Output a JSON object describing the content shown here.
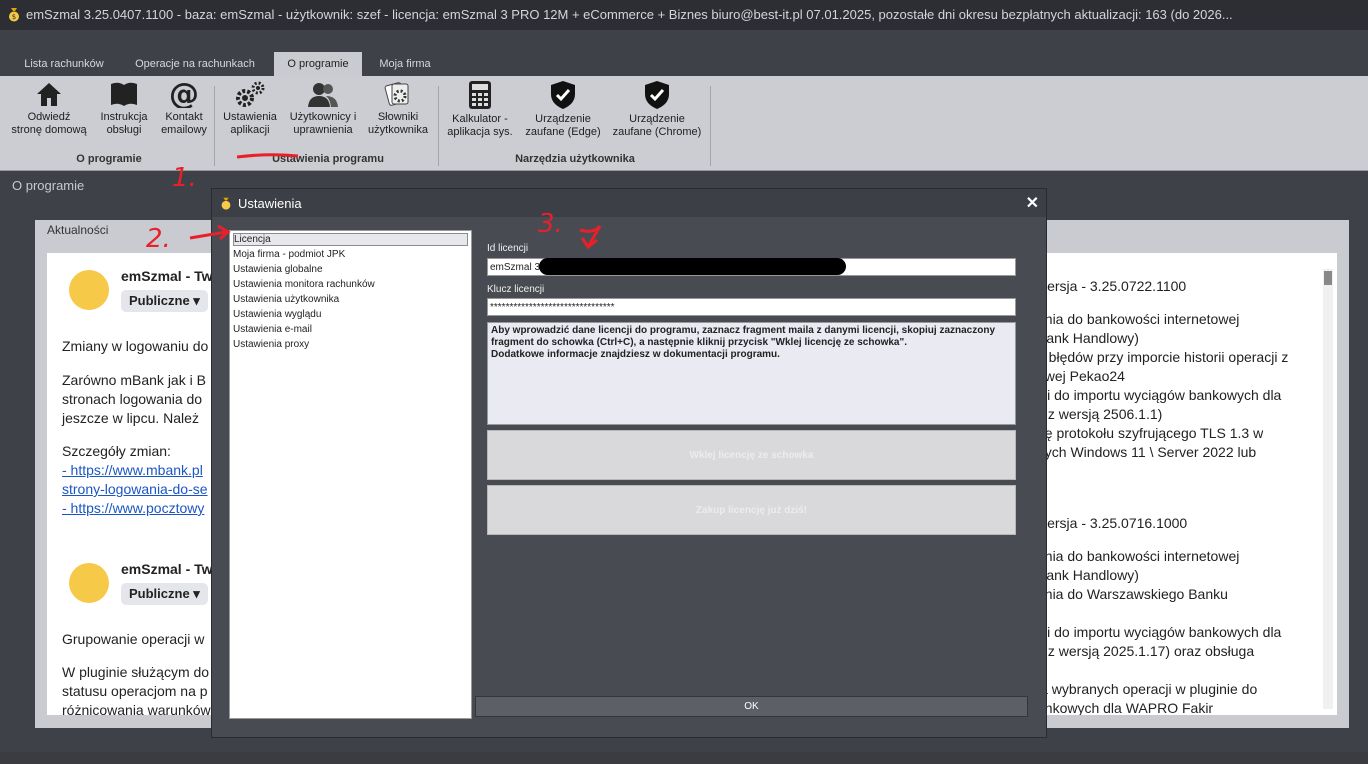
{
  "window": {
    "title": "emSzmal 3.25.0407.1100 - baza: emSzmal - użytkownik: szef - licencja: emSzmal 3 PRO 12M + eCommerce + Biznes biuro@best-it.pl 07.01.2025, pozostałe dni okresu bezpłatnych aktualizacji: 163 (do 2026..."
  },
  "tabs": [
    "Lista rachunków",
    "Operacje na rachunkach",
    "O programie",
    "Moja firma"
  ],
  "ribbon": {
    "buttons": {
      "home": [
        "Odwiedź",
        "stronę domową"
      ],
      "manual": [
        "Instrukcja",
        "obsługi"
      ],
      "email": [
        "Kontakt",
        "emailowy"
      ],
      "settings": [
        "Ustawienia",
        "aplikacji"
      ],
      "users": [
        "Użytkownicy i",
        "uprawnienia"
      ],
      "dictionaries": [
        "Słowniki",
        "użytkownika"
      ],
      "calculator": [
        "Kalkulator -",
        "aplikacja sys."
      ],
      "edge": [
        "Urządzenie",
        "zaufane (Edge)"
      ],
      "chrome": [
        "Urządzenie",
        "zaufane (Chrome)"
      ]
    },
    "groups": [
      "O programie",
      "Ustawienia programu",
      "Narzędzia użytkownika"
    ]
  },
  "section_title": "O programie",
  "news": {
    "header": "Aktualności",
    "posts": [
      {
        "author": "emSzmal - Tw",
        "badge": "Publiczne ▾",
        "lines": [
          "Zmiany w logowaniu do",
          "Zarówno mBank jak i B",
          "stronach logowania do",
          "jeszcze w lipcu. Należ"
        ],
        "details": "Szczegóły zmian:",
        "links": [
          "- https://www.mbank.pl",
          "strony-logowania-do-se",
          "- https://www.pocztowy"
        ]
      },
      {
        "author": "emSzmal - Tw",
        "badge": "Publiczne ▾",
        "lines": [
          "Grupowanie operacji w",
          "W pluginie służącym do",
          "statusu operacjom na p",
          "różnicowania warunków"
        ]
      }
    ],
    "right_column": {
      "block1": [
        "wersja - 3.25.0722.1100",
        "ania do bankowości internetowej",
        "Bank Handlowy)",
        "a błędów przy imporcie historii operacji z",
        "owej Pekao24",
        "cji do importu wyciągów bankowych dla",
        "ć z wersją 2506.1.1)",
        "gę protokołu szyfrującego TLS 1.3 w",
        "nych Windows 11 \\ Server 2022 lub"
      ],
      "block2": [
        "wersja - 3.25.0716.1000",
        "ania do bankowości internetowej",
        "Bank Handlowy)",
        "ania do Warszawskiego Banku",
        "cji do importu wyciągów bankowych dla",
        "ć z wersją 2025.1.17) oraz obsługa",
        "ia wybranych operacji w pluginie do",
        "ankowych dla WAPRO Fakir"
      ]
    }
  },
  "dialog": {
    "title": "Ustawienia",
    "tree": [
      "Licencja",
      "Moja firma - podmiot JPK",
      "Ustawienia globalne",
      "Ustawienia monitora rachunków",
      "Ustawienia użytkownika",
      "Ustawienia wyglądu",
      "Ustawienia e-mail",
      "Ustawienia proxy"
    ],
    "license_id_label": "Id licencji",
    "license_id_value": "emSzmal 3",
    "license_key_label": "Klucz licencji",
    "license_key_value": "********************************",
    "info": "Aby wprowadzić dane licencji do programu, zaznacz fragment maila z danymi licencji, skopiuj zaznaczony fragment do schowka (Ctrl+C), a następnie kliknij przycisk \"Wklej licencję ze schowka\".",
    "info2": "Dodatkowe informacje znajdziesz w dokumentacji programu.",
    "paste_button": "Wklej licencję ze schowka",
    "buy_button": "Zakup licencję już dziś!",
    "ok": "OK"
  },
  "annotations": [
    "1.",
    "2.",
    "3."
  ],
  "colors": {
    "annotation": "#e8202a",
    "accent": "#f7c948"
  }
}
